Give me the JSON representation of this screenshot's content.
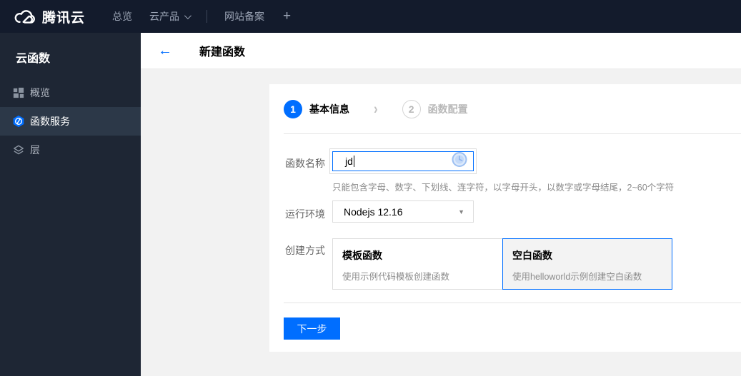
{
  "colors": {
    "accent": "#006eff",
    "topbar_bg": "#131b2c",
    "sidebar_bg": "#1e2634",
    "sidebar_selected_bg": "#2c3848",
    "content_bg": "#f2f2f2",
    "selected_card_bg": "#f3f3f3"
  },
  "icons": {
    "back": "←",
    "plus": "+",
    "dropdown_caret": "▼",
    "step_chevron": "›"
  },
  "topbar": {
    "brand": "腾讯云",
    "nav_overview": "总览",
    "nav_products": "云产品",
    "nav_beian": "网站备案"
  },
  "sidebar": {
    "title": "云函数",
    "items": [
      {
        "label": "概览",
        "icon": "grid-icon",
        "selected": false
      },
      {
        "label": "函数服务",
        "icon": "scf-hexagon-icon",
        "selected": true
      },
      {
        "label": "层",
        "icon": "layers-icon",
        "selected": false
      }
    ]
  },
  "header": {
    "title": "新建函数"
  },
  "steps": {
    "step1_num": "1",
    "step1_label": "基本信息",
    "step2_num": "2",
    "step2_label": "函数配置"
  },
  "form": {
    "name_label": "函数名称",
    "name_value": "jd",
    "name_hint": "只能包含字母、数字、下划线、连字符，以字母开头，以数字或字母结尾，2~60个字符",
    "runtime_label": "运行环境",
    "runtime_value": "Nodejs 12.16",
    "method_label": "创建方式",
    "methods": [
      {
        "title": "模板函数",
        "desc": "使用示例代码模板创建函数",
        "selected": false
      },
      {
        "title": "空白函数",
        "desc": "使用helloworld示例创建空白函数",
        "selected": true
      }
    ],
    "next_button": "下一步"
  }
}
